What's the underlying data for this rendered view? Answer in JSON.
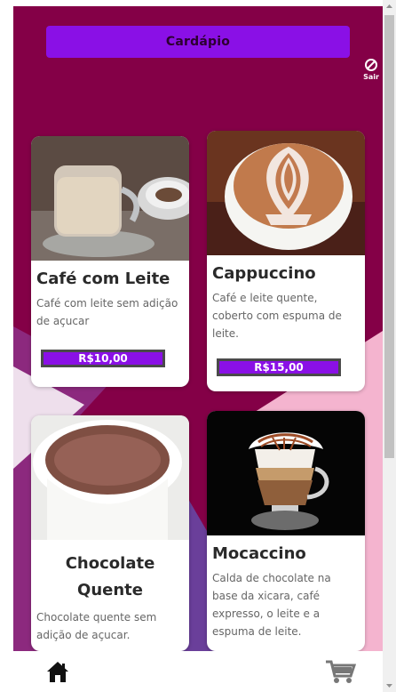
{
  "header": {
    "title": "Cardápio"
  },
  "logout": {
    "label": "Sair",
    "icon": "block-icon"
  },
  "products": [
    {
      "name": "Café com Leite",
      "description": "Café com leite sem adição de açucar",
      "price": "R$10,00",
      "image": "coffee-with-milk-image"
    },
    {
      "name": "Cappuccino",
      "description": "Café e leite quente, coberto com espuma de leite.",
      "price": "R$15,00",
      "image": "cappuccino-image"
    },
    {
      "name": "Chocolate Quente",
      "description": "Chocolate quente sem adição de açucar.",
      "image": "hot-chocolate-image"
    },
    {
      "name": "Mocaccino",
      "description": "Calda de chocolate na base da xicara, café expresso, o leite e a espuma de leite.",
      "image": "mocaccino-image"
    }
  ],
  "bottom_nav": {
    "home_icon": "home-icon",
    "cart_icon": "cart-icon"
  },
  "colors": {
    "background": "#840047",
    "accent": "#8a10e6",
    "price_border": "#4a4a4a",
    "light_pink": "#f5b4cd",
    "purple_band": "#b25aa7"
  }
}
